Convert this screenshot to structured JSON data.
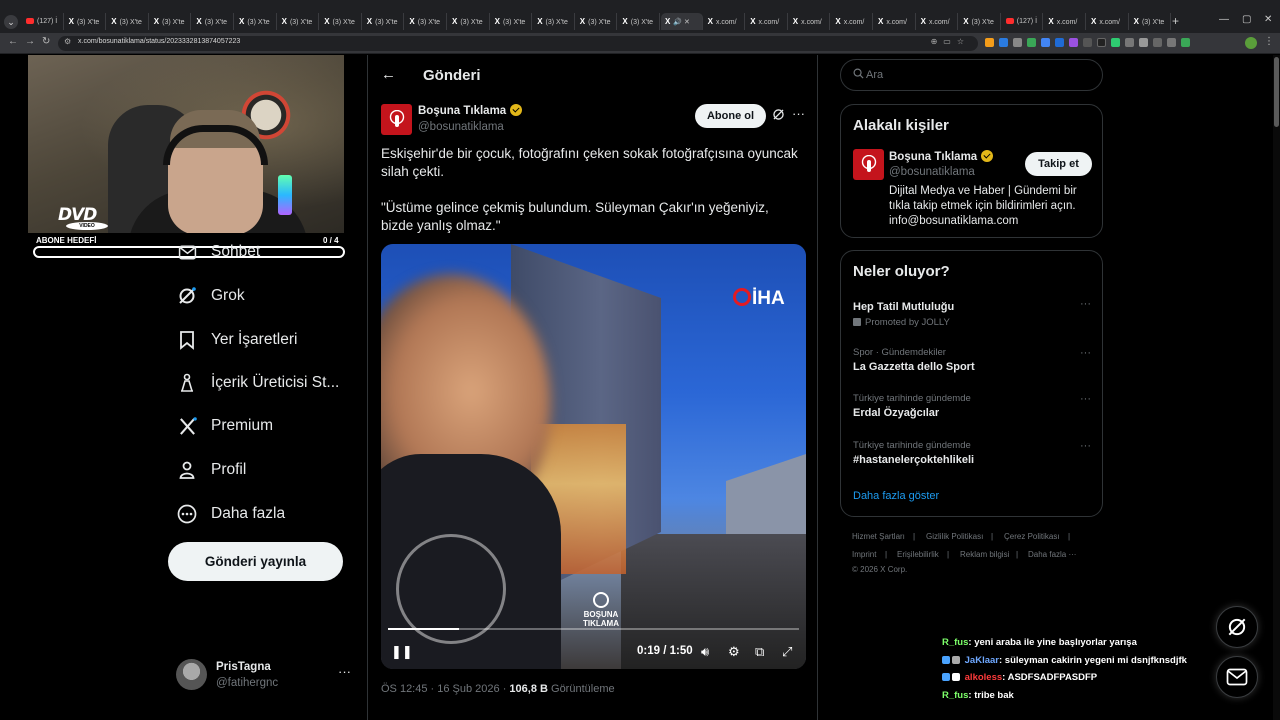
{
  "browser": {
    "tabs": [
      {
        "icon": "youtube",
        "label": "(127) İ"
      },
      {
        "icon": "x",
        "label": "(3) X'te"
      },
      {
        "icon": "x",
        "label": "(3) X'te"
      },
      {
        "icon": "x",
        "label": "(3) X'te"
      },
      {
        "icon": "x",
        "label": "(3) X'te"
      },
      {
        "icon": "x",
        "label": "(3) X'te"
      },
      {
        "icon": "x",
        "label": "(3) X'te"
      },
      {
        "icon": "x",
        "label": "(3) X'te"
      },
      {
        "icon": "x",
        "label": "(3) X'te"
      },
      {
        "icon": "x",
        "label": "(3) X'te"
      },
      {
        "icon": "x",
        "label": "(3) X'te"
      },
      {
        "icon": "x",
        "label": "(3) X'te"
      },
      {
        "icon": "x",
        "label": "(3) X'te"
      },
      {
        "icon": "x",
        "label": "(3) X'te"
      },
      {
        "icon": "x",
        "label": "(3) X'te"
      },
      {
        "icon": "x",
        "label": "🔊 ✕",
        "active": true
      },
      {
        "icon": "x",
        "label": "x.com/"
      },
      {
        "icon": "x",
        "label": "x.com/"
      },
      {
        "icon": "x",
        "label": "x.com/"
      },
      {
        "icon": "x",
        "label": "x.com/"
      },
      {
        "icon": "x",
        "label": "x.com/"
      },
      {
        "icon": "x",
        "label": "x.com/"
      },
      {
        "icon": "x",
        "label": "(3) X'te"
      },
      {
        "icon": "youtube",
        "label": "(127) İ"
      },
      {
        "icon": "x",
        "label": "x.com/"
      },
      {
        "icon": "x",
        "label": "x.com/"
      },
      {
        "icon": "x",
        "label": "(3) X'te"
      }
    ],
    "new_tab": "+",
    "url": "x.com/bosunatiklama/status/2023332813874057223"
  },
  "overlay": {
    "goal_label": "ABONE HEDEFİ",
    "goal_count": "0 / 4",
    "goal_fraction": 0,
    "dvd_text": "DVD",
    "dvd_sub": "VIDEO"
  },
  "nav": {
    "items": [
      {
        "icon": "mail-icon",
        "label": "Sohbet"
      },
      {
        "icon": "grok-icon",
        "label": "Grok"
      },
      {
        "icon": "bookmark-icon",
        "label": "Yer İşaretleri"
      },
      {
        "icon": "creator-studio-icon",
        "label": "İçerik Üreticisi St..."
      },
      {
        "icon": "x-logo-icon",
        "label": "Premium"
      },
      {
        "icon": "profile-icon",
        "label": "Profil"
      },
      {
        "icon": "more-circle-icon",
        "label": "Daha fazla"
      }
    ],
    "post_button": "Gönderi yayınla",
    "account": {
      "name": "PrisTagna",
      "handle": "@fatihergnc",
      "more": "···"
    }
  },
  "main": {
    "title": "Gönderi",
    "tweet": {
      "author_name": "Boşuna Tıklama",
      "author_handle": "@bosunatiklama",
      "subscribe": "Abone ol",
      "text1": "Eskişehir'de bir çocuk, fotoğrafını çeken sokak fotoğrafçısına oyuncak silah çekti.",
      "text2": "\"Üstüme gelince çekmiş bulundum. Süleyman Çakır'ın yeğeniyiz, bizde yanlış olmaz.\"",
      "video": {
        "time": "0:19 / 1:50",
        "progress_fraction": 0.173,
        "agency_logo": "İHA",
        "watermark": "BOŞUNA TIKLAMA"
      },
      "meta_time": "ÖS 12:45 · 16 Şub 2026 · ",
      "views": "106,8 B",
      "views_label": " Görüntüleme"
    }
  },
  "sidebar": {
    "search_placeholder": "Ara",
    "related": {
      "title": "Alakalı kişiler",
      "name": "Boşuna Tıklama",
      "handle": "@bosunatiklama",
      "follow": "Takip et",
      "bio": "Dijital Medya ve Haber | Gündemi bir tıkla takip etmek için bildirimleri açın. info@bosunatiklama.com"
    },
    "trends": {
      "title": "Neler oluyor?",
      "items": [
        {
          "name": "Hep Tatil Mutluluğu",
          "promoted": "Promoted by JOLLY"
        },
        {
          "category": "Spor · Gündemdekiler",
          "name": "La Gazzetta dello Sport"
        },
        {
          "category": "Türkiye tarihinde gündemde",
          "name": "Erdal Özyağcılar"
        },
        {
          "category": "Türkiye tarihinde gündemde",
          "name": "#hastanelerçoktehlikeli"
        }
      ],
      "more_dots": "···",
      "show_more": "Daha fazla göster"
    },
    "footer": {
      "links": [
        "Hizmet Şartları",
        "Gizlilik Politikası",
        "Çerez Politikası",
        "Imprint",
        "Erişilebilirlik",
        "Reklam bilgisi",
        "Daha fazla ···"
      ],
      "separator": "|",
      "copyright": "© 2026 X Corp."
    }
  },
  "chat": {
    "messages": [
      {
        "user": "R_fus",
        "user_color": "#7dff6a",
        "text": ": yeni araba ile yine başlıyorlar yarışa"
      },
      {
        "user": "JaKlaar",
        "user_color": "#6fa8ff",
        "text": ": süleyman cakirin yegeni mi dsnjfknsdjfk"
      },
      {
        "user": "alkoless",
        "user_color": "#ff3b3b",
        "text": ": ASDFSADFPASDFP"
      },
      {
        "user": "R_fus",
        "user_color": "#7dff6a",
        "text": ": tribe bak"
      }
    ]
  },
  "colors": {
    "accent": "#1d9bf0",
    "verified": "#e2b719",
    "brand_red": "#c4141c"
  }
}
